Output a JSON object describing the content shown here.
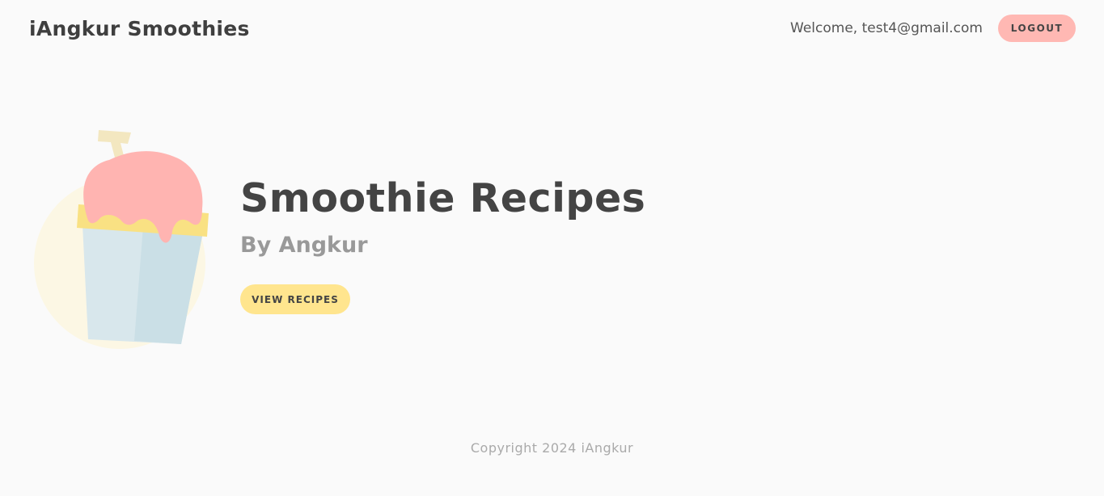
{
  "header": {
    "brand": "iAngkur Smoothies",
    "welcome": "Welcome, test4@gmail.com",
    "logout_label": "LOGOUT"
  },
  "hero": {
    "title": "Smoothie Recipes",
    "subtitle": "By Angkur",
    "view_recipes_label": "VIEW RECIPES",
    "illustration_icon": "smoothie-cup-icon"
  },
  "footer": {
    "copyright": "Copyright 2024 iAngkur"
  },
  "colors": {
    "background": "#fafafa",
    "logout_button": "#ffb8b3",
    "view_button": "#ffe58e",
    "smoothie_pink": "#ffb4b1",
    "cup_blue": "#d8e7ec",
    "lid_yellow": "#f9e183"
  }
}
